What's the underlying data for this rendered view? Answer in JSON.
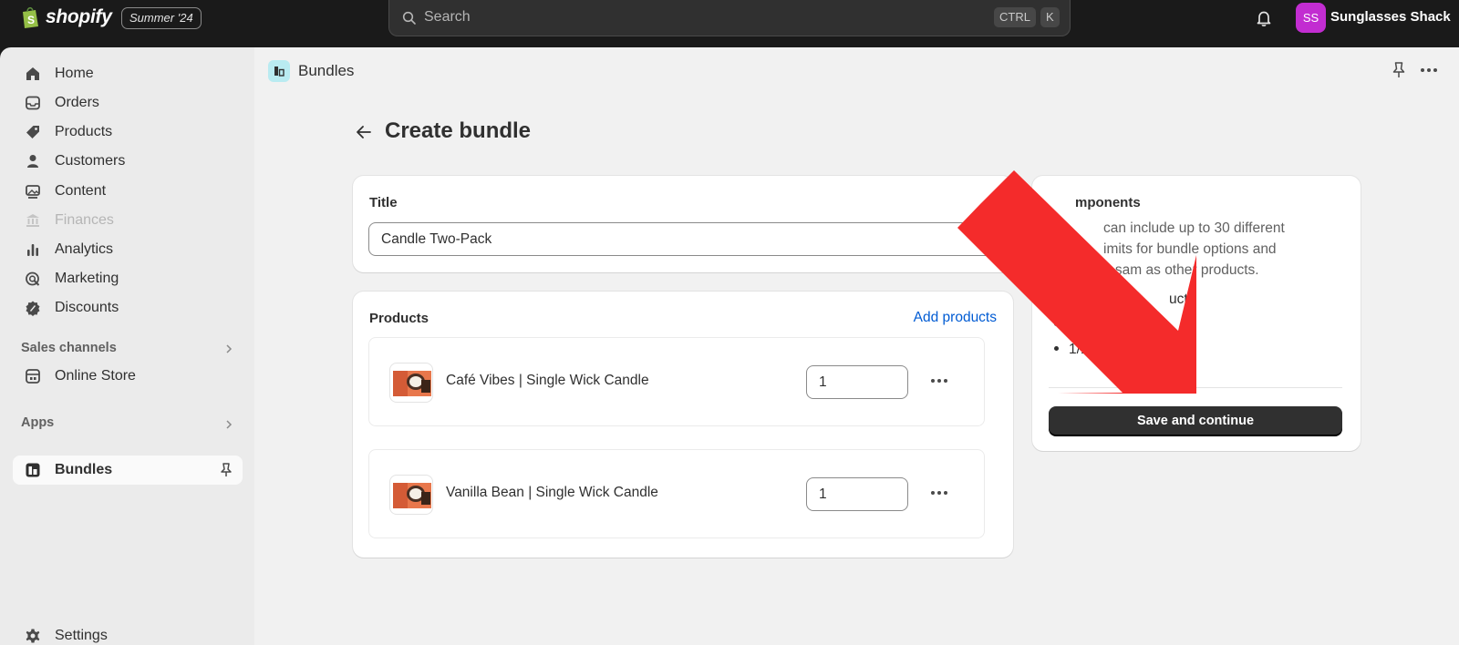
{
  "topbar": {
    "brand": "shopify",
    "edition": "Summer '24",
    "search_placeholder": "Search",
    "shortcut_key1": "CTRL",
    "shortcut_key2": "K",
    "avatar_initials": "SS",
    "store_name": "Sunglasses Shack"
  },
  "sidebar": {
    "items": [
      {
        "label": "Home",
        "icon": "home-icon"
      },
      {
        "label": "Orders",
        "icon": "inbox-icon"
      },
      {
        "label": "Products",
        "icon": "tag-icon"
      },
      {
        "label": "Customers",
        "icon": "person-icon"
      },
      {
        "label": "Content",
        "icon": "image-icon"
      },
      {
        "label": "Finances",
        "icon": "bank-icon"
      },
      {
        "label": "Analytics",
        "icon": "bar-chart-icon"
      },
      {
        "label": "Marketing",
        "icon": "target-icon"
      },
      {
        "label": "Discounts",
        "icon": "discount-icon"
      }
    ],
    "sales_channels_heading": "Sales channels",
    "online_store": "Online Store",
    "apps_heading": "Apps",
    "bundles": "Bundles",
    "settings": "Settings"
  },
  "header": {
    "breadcrumb": "Bundles"
  },
  "page": {
    "title": "Create bundle",
    "title_card": {
      "label": "Title",
      "value": "Candle Two-Pack"
    },
    "products_card": {
      "label": "Products",
      "add_link": "Add products",
      "rows": [
        {
          "name": "Café Vibes | Single Wick Candle",
          "qty": "1"
        },
        {
          "name": "Vanilla Bean | Single Wick Candle",
          "qty": "1"
        }
      ]
    },
    "components_card": {
      "heading_visible": "mponents",
      "line1": "can include up to 30 different",
      "line2": "imits for bundle options and",
      "line3": "e sam  as other products.",
      "line4": "ucts",
      "line5": "1/1",
      "save_button": "Save and continue"
    }
  },
  "colors": {
    "accent_link": "#005bd3",
    "annotation_arrow": "#f42b2b",
    "avatar_bg": "#c22dd1"
  }
}
